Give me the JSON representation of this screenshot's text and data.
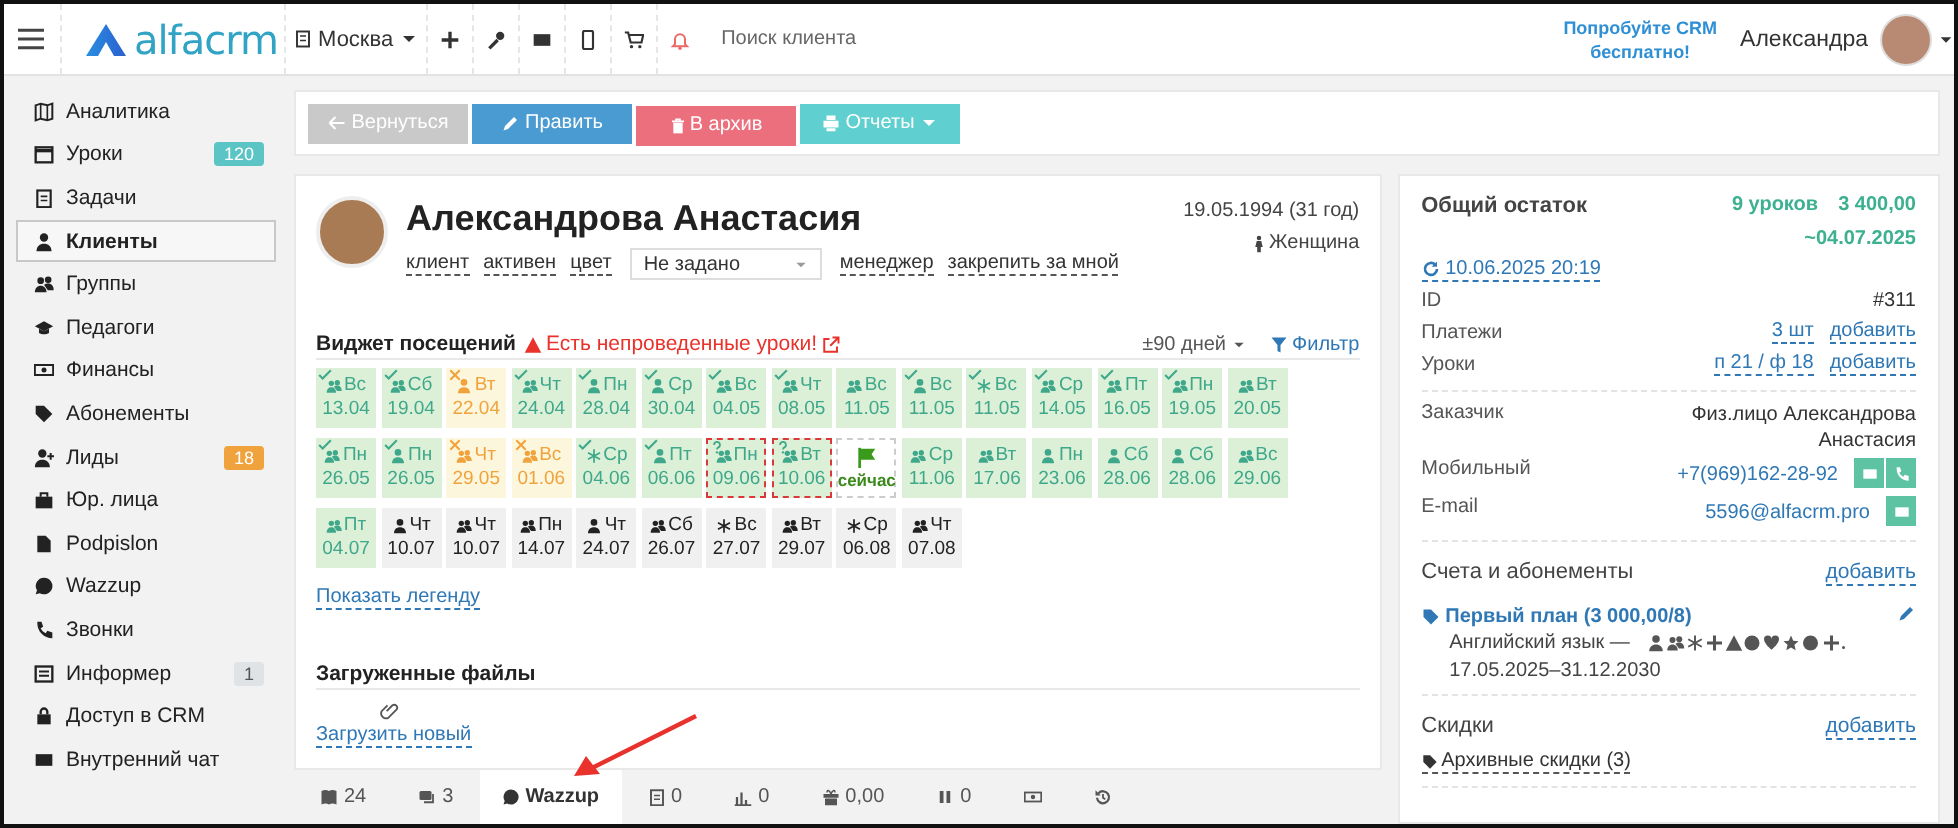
{
  "topbar": {
    "logo": "alfacrm",
    "branch": "Москва",
    "search": {
      "placeholder": "Поиск клиента"
    },
    "promo": "Попробуйте CRM бесплатно!",
    "user": "Александра"
  },
  "sidebar": {
    "items": [
      {
        "label": "Аналитика",
        "selected": false
      },
      {
        "label": "Уроки",
        "selected": false,
        "badge": "120",
        "color": "#5bc5c6"
      },
      {
        "label": "Задачи",
        "selected": false
      },
      {
        "label": "Клиенты",
        "selected": true
      },
      {
        "label": "Группы",
        "selected": false
      },
      {
        "label": "Педагоги",
        "selected": false
      },
      {
        "label": "Финансы",
        "selected": false
      },
      {
        "label": "Абонементы",
        "selected": false
      },
      {
        "label": "Лиды",
        "selected": false,
        "badge": "18",
        "color": "#f0a33c"
      },
      {
        "label": "Юр. лица",
        "selected": false
      },
      {
        "label": "Podpislon",
        "selected": false
      },
      {
        "label": "Wazzup",
        "selected": false
      },
      {
        "label": "Звонки",
        "selected": false
      },
      {
        "label": "Информер",
        "selected": false,
        "badge": "1",
        "color": "#dfe3e6"
      },
      {
        "label": "Доступ в CRM",
        "selected": false
      },
      {
        "label": "Внутренний чат",
        "selected": false
      }
    ]
  },
  "toolbar": {
    "buttons": [
      {
        "label": "Вернуться",
        "kind": "back"
      },
      {
        "label": "Править",
        "kind": "edit"
      },
      {
        "label": "В архив",
        "kind": "archive"
      },
      {
        "label": "Отчеты",
        "kind": "reports"
      }
    ]
  },
  "profile": {
    "name": "Александрова Анастасия",
    "tags": [
      "клиент",
      "активен",
      "цвет"
    ],
    "color_select": "Не задано",
    "links": [
      "менеджер",
      "закрепить за мной"
    ],
    "birth": "19.05.1994 (31 год)",
    "gender": "Женщина"
  },
  "attendance": {
    "title": "Виджет посещений",
    "warning": "Есть непроведенные уроки!",
    "range": "±90 дней",
    "filter": "Фильтр",
    "legend_link": "Показать легенду",
    "tiles": [
      {
        "day": "Вс",
        "date": "13.04",
        "kind": "attended",
        "group": true,
        "trial": false
      },
      {
        "day": "Сб",
        "date": "19.04",
        "kind": "attended",
        "group": true,
        "trial": false
      },
      {
        "day": "Вт",
        "date": "22.04",
        "kind": "missed",
        "group": false,
        "trial": false
      },
      {
        "day": "Чт",
        "date": "24.04",
        "kind": "attended",
        "group": true,
        "trial": false
      },
      {
        "day": "Пн",
        "date": "28.04",
        "kind": "attended",
        "group": false,
        "trial": false
      },
      {
        "day": "Ср",
        "date": "30.04",
        "kind": "attended",
        "group": false,
        "trial": false
      },
      {
        "day": "Вс",
        "date": "04.05",
        "kind": "attended",
        "group": true,
        "trial": false
      },
      {
        "day": "Чт",
        "date": "08.05",
        "kind": "attended",
        "group": true,
        "trial": false
      },
      {
        "day": "Вс",
        "date": "11.05",
        "kind": "planned",
        "group": true,
        "trial": false
      },
      {
        "day": "Вс",
        "date": "11.05",
        "kind": "attended",
        "group": false,
        "trial": false
      },
      {
        "day": "Вс",
        "date": "11.05",
        "kind": "attended",
        "trial": true
      },
      {
        "day": "Ср",
        "date": "14.05",
        "kind": "attended",
        "group": true,
        "trial": false
      },
      {
        "day": "Пт",
        "date": "16.05",
        "kind": "attended",
        "group": true,
        "trial": false
      },
      {
        "day": "Пн",
        "date": "19.05",
        "kind": "attended",
        "group": true,
        "trial": false
      },
      {
        "day": "Вт",
        "date": "20.05",
        "kind": "planned",
        "group": true,
        "trial": false
      },
      {
        "day": "Пн",
        "date": "26.05",
        "kind": "attended",
        "group": true,
        "trial": false
      },
      {
        "day": "Пн",
        "date": "26.05",
        "kind": "attended",
        "group": false,
        "trial": false
      },
      {
        "day": "Чт",
        "date": "29.05",
        "kind": "missed",
        "group": true,
        "trial": false
      },
      {
        "day": "Вс",
        "date": "01.06",
        "kind": "missed",
        "group": true,
        "trial": false
      },
      {
        "day": "Ср",
        "date": "04.06",
        "kind": "attended",
        "trial": true
      },
      {
        "day": "Пт",
        "date": "06.06",
        "kind": "attended",
        "group": false,
        "trial": false
      },
      {
        "day": "Пн",
        "date": "09.06",
        "kind": "unchecked",
        "group": true,
        "trial": false
      },
      {
        "day": "Вт",
        "date": "10.06",
        "kind": "unchecked",
        "group": true,
        "trial": false
      },
      {
        "day": "сейчас",
        "kind": "now"
      },
      {
        "day": "Ср",
        "date": "11.06",
        "kind": "planned",
        "group": true,
        "trial": false
      },
      {
        "day": "Вт",
        "date": "17.06",
        "kind": "planned",
        "group": true,
        "trial": false
      },
      {
        "day": "Пн",
        "date": "23.06",
        "kind": "planned",
        "group": false,
        "trial": false
      },
      {
        "day": "Сб",
        "date": "28.06",
        "kind": "planned",
        "group": false,
        "trial": false
      },
      {
        "day": "Сб",
        "date": "28.06",
        "kind": "planned",
        "group": false,
        "trial": false
      },
      {
        "day": "Вс",
        "date": "29.06",
        "kind": "planned",
        "group": true,
        "trial": false
      },
      {
        "day": "Пт",
        "date": "04.07",
        "kind": "planned",
        "group": true,
        "trial": false
      },
      {
        "day": "Чт",
        "date": "10.07",
        "kind": "future",
        "group": false,
        "trial": false
      },
      {
        "day": "Чт",
        "date": "10.07",
        "kind": "future",
        "group": true,
        "trial": false
      },
      {
        "day": "Пн",
        "date": "14.07",
        "kind": "future",
        "group": true,
        "trial": false
      },
      {
        "day": "Чт",
        "date": "24.07",
        "kind": "future",
        "group": false,
        "trial": false
      },
      {
        "day": "Сб",
        "date": "26.07",
        "kind": "future",
        "group": true,
        "trial": false
      },
      {
        "day": "Вс",
        "date": "27.07",
        "kind": "future",
        "trial": true
      },
      {
        "day": "Вт",
        "date": "29.07",
        "kind": "future",
        "group": true,
        "trial": false
      },
      {
        "day": "Ср",
        "date": "06.08",
        "kind": "future",
        "trial": true
      },
      {
        "day": "Чт",
        "date": "07.08",
        "kind": "future",
        "group": true,
        "trial": false
      }
    ]
  },
  "files": {
    "title": "Загруженные файлы",
    "upload": "Загрузить новый"
  },
  "bottom_tabs": [
    {
      "label": "24",
      "selected": false
    },
    {
      "label": "3",
      "selected": false
    },
    {
      "label": "Wazzup",
      "selected": true
    },
    {
      "label": "0",
      "selected": false
    },
    {
      "label": "0",
      "selected": false
    },
    {
      "label": "0,00",
      "selected": false
    },
    {
      "label": "0",
      "selected": false
    },
    {
      "selected": false
    },
    {
      "selected": false
    }
  ],
  "summary": {
    "title": "Общий остаток",
    "lessons": "9 уроков",
    "amount": "3 400,00",
    "until": "~04.07.2025",
    "sync": "10.06.2025 20:19",
    "fields": [
      {
        "label": "ID",
        "value": "#311"
      },
      {
        "label": "Платежи",
        "value": "3 шт",
        "action": "добавить"
      },
      {
        "label": "Уроки",
        "value": "п 21 / ф 18",
        "action": "добавить"
      }
    ]
  },
  "contacts": [
    {
      "label": "Заказчик",
      "value": "Физ.лицо Александрова Анастасия",
      "kind": "text"
    },
    {
      "label": "Мобильный",
      "value": "+7(969)162-28-92",
      "kind": "phone"
    },
    {
      "label": "E-mail",
      "value": "5596@alfacrm.pro",
      "kind": "email"
    }
  ],
  "accounts": {
    "title": "Счета и абонементы",
    "action": "добавить",
    "plan": {
      "name": "Первый план (3 000,00/8)",
      "subject": "Английский язык —",
      "period": "17.05.2025–31.12.2030"
    }
  },
  "discounts": {
    "title": "Скидки",
    "action": "добавить",
    "archive": "Архивные скидки (3)"
  }
}
